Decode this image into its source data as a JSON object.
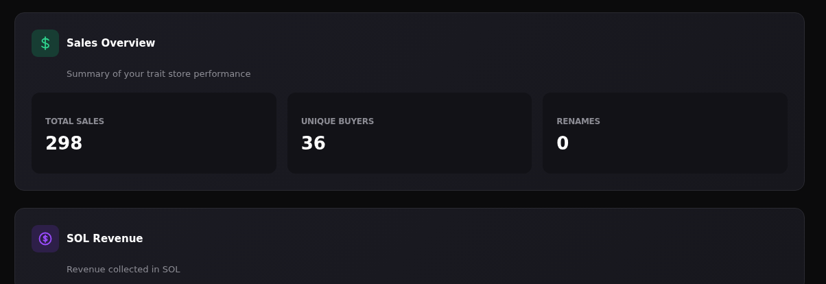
{
  "sections": [
    {
      "kind": "sales",
      "title": "Sales Overview",
      "subtitle": "Summary of your trait store performance",
      "stats": [
        {
          "label": "TOTAL SALES",
          "value": "298"
        },
        {
          "label": "UNIQUE BUYERS",
          "value": "36"
        },
        {
          "label": "RENAMES",
          "value": "0"
        }
      ]
    },
    {
      "kind": "revenue",
      "title": "SOL Revenue",
      "subtitle": "Revenue collected in SOL"
    }
  ]
}
